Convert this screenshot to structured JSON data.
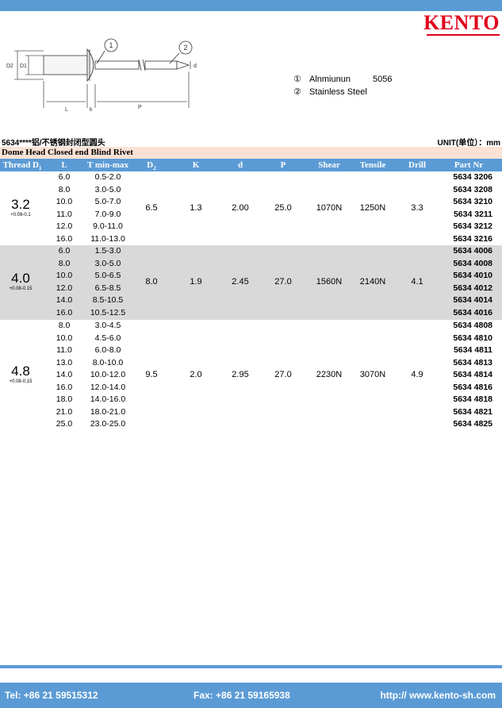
{
  "header": {
    "logo": "KENTO"
  },
  "drawing": {
    "callout_1": "1",
    "callout_2": "2",
    "label_d2": "D2",
    "label_d1": "D1",
    "label_d": "d",
    "label_l": "L",
    "label_k": "k",
    "label_p": "P"
  },
  "materials": [
    {
      "num": "①",
      "name": "Alnmiunun",
      "grade": "5056"
    },
    {
      "num": "②",
      "name": "Stainless Steel",
      "grade": ""
    }
  ],
  "subhead": {
    "code_cn": "5634****铝/不锈钢封闭型圆头",
    "unit": "UNIT(单位）：mm"
  },
  "title": "Dome Head Closed end Blind Rivet",
  "columns": {
    "thread": "Thread D",
    "thread_sub": "1",
    "L": "L",
    "T": "T min-max",
    "D2": "D",
    "D2_sub": "2",
    "K": "K",
    "d": "d",
    "P": "P",
    "shear": "Shear",
    "tensile": "Tensile",
    "drill": "Drill",
    "part": "Part Nr"
  },
  "groups": [
    {
      "thread": "3.2",
      "tolerance": "+0.08-0.1",
      "D2": "6.5",
      "K": "1.3",
      "d": "2.00",
      "P": "25.0",
      "shear": "1070N",
      "tensile": "1250N",
      "drill": "3.3",
      "rows": [
        {
          "L": "6.0",
          "T": "0.5-2.0",
          "part": "5634 3206"
        },
        {
          "L": "8.0",
          "T": "3.0-5.0",
          "part": "5634 3208"
        },
        {
          "L": "10.0",
          "T": "5.0-7.0",
          "part": "5634 3210"
        },
        {
          "L": "11.0",
          "T": "7.0-9.0",
          "part": "5634 3211"
        },
        {
          "L": "12.0",
          "T": "9.0-11.0",
          "part": "5634 3212"
        },
        {
          "L": "16.0",
          "T": "11.0-13.0",
          "part": "5634 3216"
        }
      ]
    },
    {
      "thread": "4.0",
      "tolerance": "+0.08-0.15",
      "D2": "8.0",
      "K": "1.9",
      "d": "2.45",
      "P": "27.0",
      "shear": "1560N",
      "tensile": "2140N",
      "drill": "4.1",
      "rows": [
        {
          "L": "6.0",
          "T": "1.5-3.0",
          "part": "5634 4006"
        },
        {
          "L": "8.0",
          "T": "3.0-5.0",
          "part": "5634 4008"
        },
        {
          "L": "10.0",
          "T": "5.0-6.5",
          "part": "5634 4010"
        },
        {
          "L": "12.0",
          "T": "6.5-8.5",
          "part": "5634 4012"
        },
        {
          "L": "14.0",
          "T": "8.5-10.5",
          "part": "5634 4014"
        },
        {
          "L": "16.0",
          "T": "10.5-12.5",
          "part": "5634 4016"
        }
      ]
    },
    {
      "thread": "4.8",
      "tolerance": "+0.08-0.15",
      "D2": "9.5",
      "K": "2.0",
      "d": "2.95",
      "P": "27.0",
      "shear": "2230N",
      "tensile": "3070N",
      "drill": "4.9",
      "rows": [
        {
          "L": "8.0",
          "T": "3.0-4.5",
          "part": "5634 4808"
        },
        {
          "L": "10.0",
          "T": "4.5-6.0",
          "part": "5634 4810"
        },
        {
          "L": "11.0",
          "T": "6.0-8.0",
          "part": "5634 4811"
        },
        {
          "L": "13.0",
          "T": "8.0-10.0",
          "part": "5634 4813"
        },
        {
          "L": "14.0",
          "T": "10.0-12.0",
          "part": "5634 4814"
        },
        {
          "L": "16.0",
          "T": "12.0-14.0",
          "part": "5634 4816"
        },
        {
          "L": "18.0",
          "T": "14.0-16.0",
          "part": "5634 4818"
        },
        {
          "L": "21.0",
          "T": "18.0-21.0",
          "part": "5634 4821"
        },
        {
          "L": "25.0",
          "T": "23.0-25.0",
          "part": "5634 4825"
        }
      ]
    }
  ],
  "footer": {
    "tel": "Tel: +86 21 59515312",
    "fax": "Fax: +86 21 59165938",
    "web": "http:// www.kento-sh.com"
  },
  "colors": {
    "accent_blue": "#5b9bd5",
    "title_band": "#fbe2d5",
    "shade_gray": "#d9d9d9",
    "logo_red": "#e0001b"
  }
}
